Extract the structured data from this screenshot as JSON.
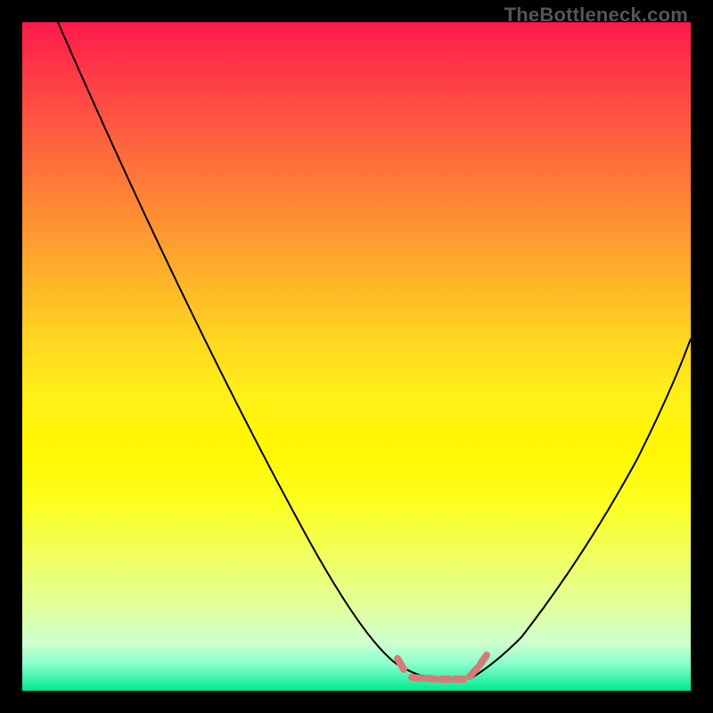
{
  "attribution": "TheBottleneck.com",
  "chart_data": {
    "type": "line",
    "title": "",
    "xlabel": "",
    "ylabel": "",
    "ylim": [
      0,
      100
    ],
    "x": [
      0,
      5,
      10,
      15,
      20,
      25,
      30,
      35,
      40,
      45,
      50,
      55,
      57,
      60,
      63,
      65,
      67,
      70,
      75,
      80,
      85,
      90,
      95,
      100
    ],
    "series": [
      {
        "name": "bottleneck-curve",
        "values": [
          100,
          92,
          84,
          76,
          67,
          58,
          49,
          40,
          31,
          22,
          13,
          5,
          2,
          1,
          0,
          0,
          2,
          6,
          14,
          22,
          31,
          40,
          49,
          58
        ]
      }
    ],
    "markers": {
      "name": "optimal-zone",
      "color": "#d87a78",
      "points_x": [
        55,
        57,
        59,
        61,
        63,
        65,
        67
      ],
      "points_y": [
        5,
        2,
        1,
        0,
        0,
        0,
        2
      ]
    },
    "gradient_colors": {
      "top": "#ff1a4a",
      "mid": "#ffd820",
      "bottom": "#00e890"
    }
  }
}
